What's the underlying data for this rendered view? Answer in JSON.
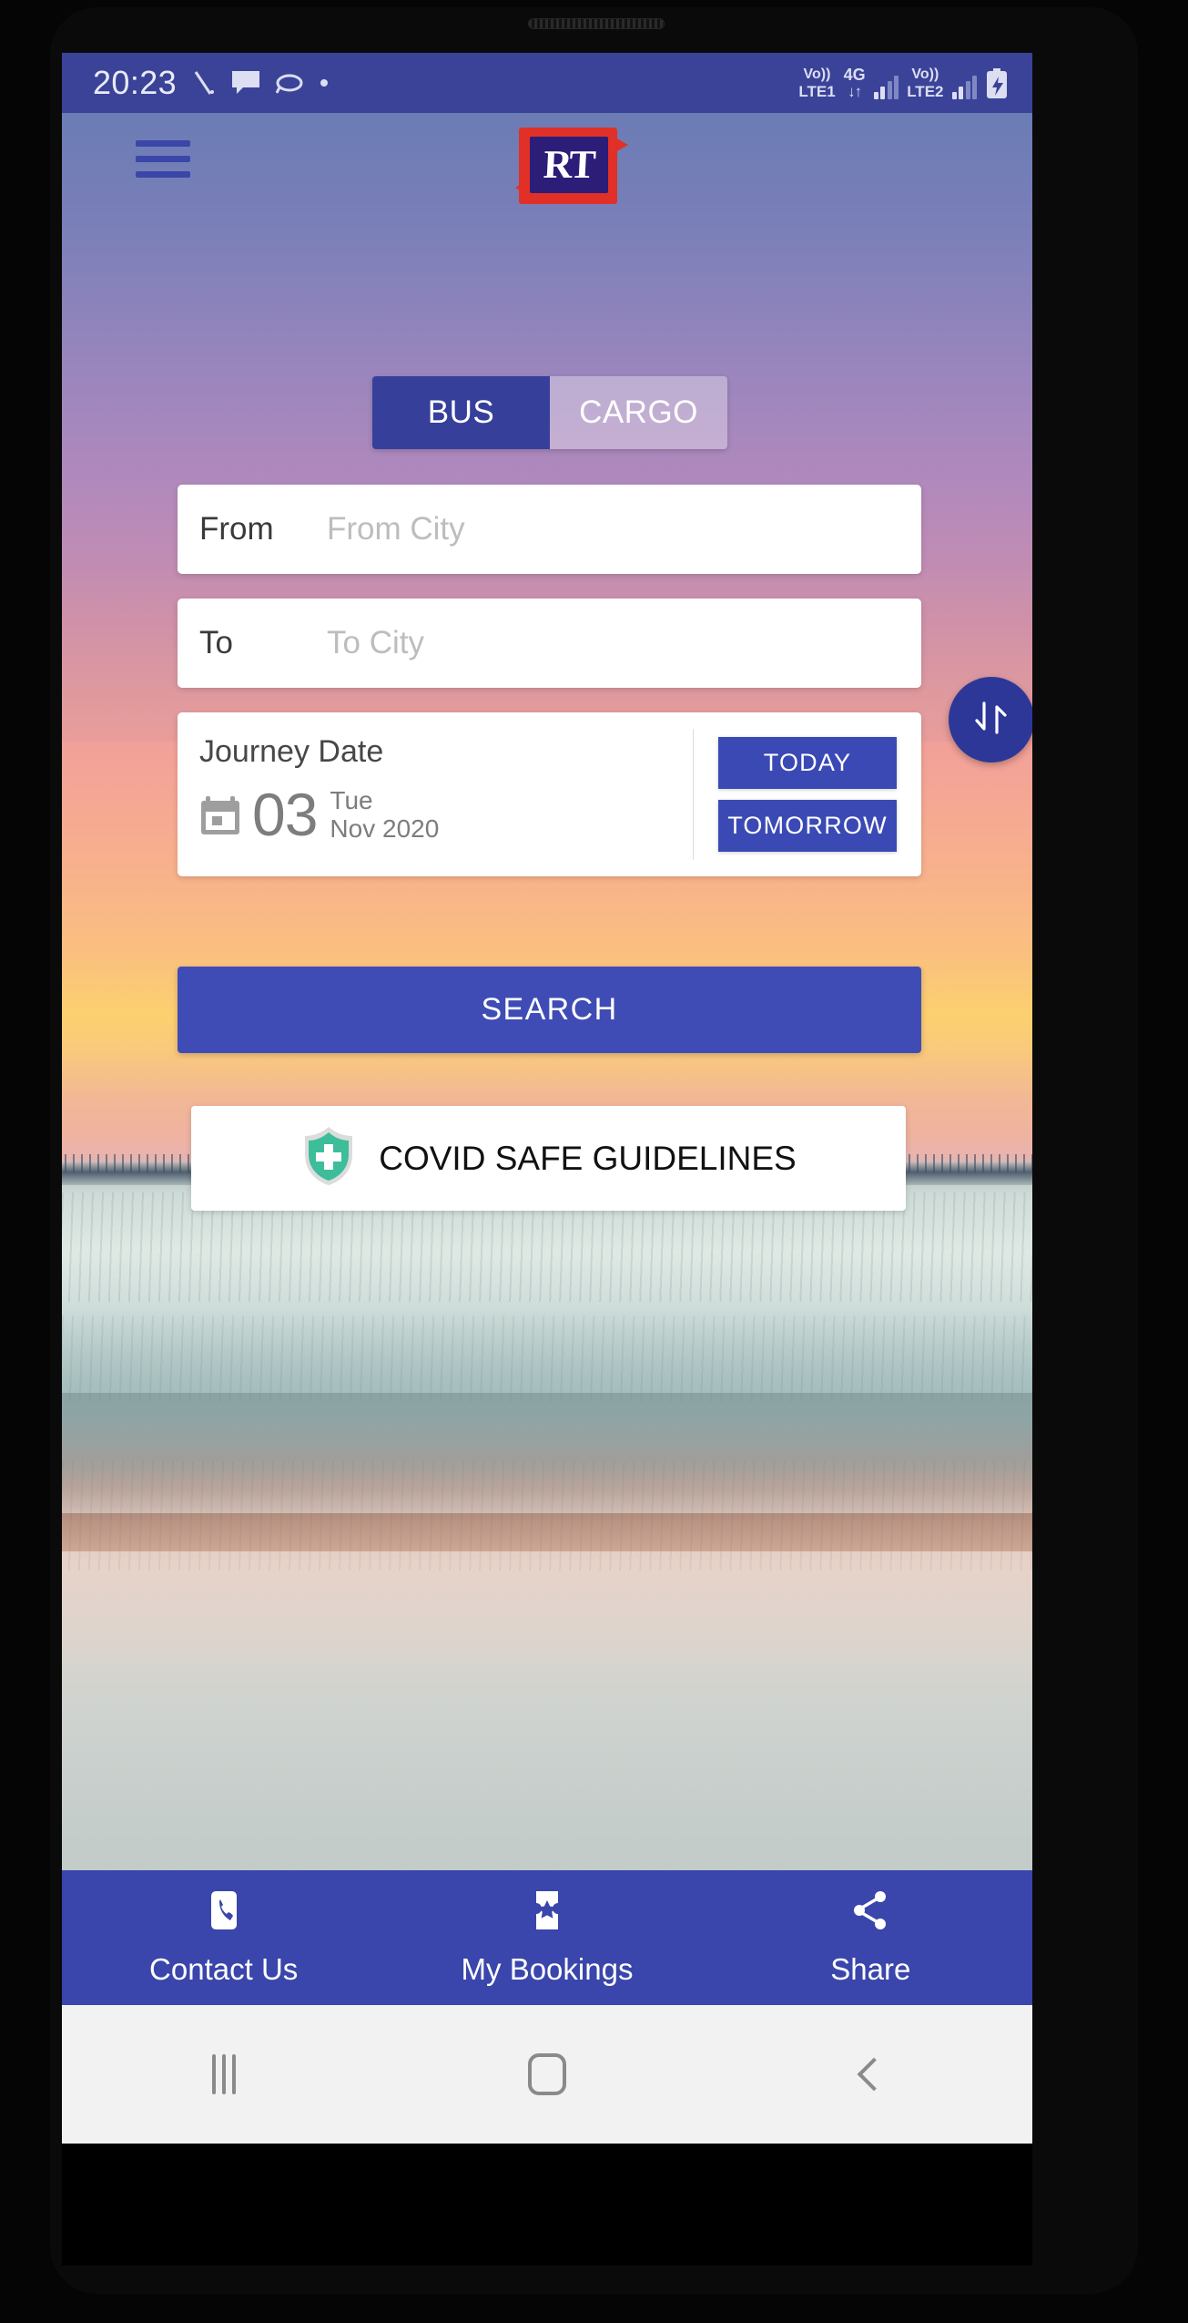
{
  "status_bar": {
    "time": "20:23",
    "left_icons": [
      "silent-mode-icon",
      "message-icon",
      "app-icon",
      "dot-icon"
    ],
    "network": {
      "sim1_volte_line1": "Vo))",
      "sim1_volte_line2": "LTE1",
      "data_type": "4G",
      "data_arrows": "↓↑",
      "sim2_volte_line1": "Vo))",
      "sim2_volte_line2": "LTE2"
    },
    "battery_icon": "battery-charging-icon",
    "background_color": "#3a4398"
  },
  "header": {
    "menu_icon": "hamburger-menu-icon",
    "logo_text": "RT",
    "logo_colors": {
      "frame": "#e03027",
      "inner": "#2b1d78",
      "text": "#ffffff"
    }
  },
  "mode_tabs": [
    {
      "label": "BUS",
      "active": true
    },
    {
      "label": "CARGO",
      "active": false
    }
  ],
  "search_form": {
    "from": {
      "label": "From",
      "value": "",
      "placeholder": "From City"
    },
    "to": {
      "label": "To",
      "value": "",
      "placeholder": "To City"
    },
    "swap_icon": "swap-vertical-icon",
    "journey": {
      "title": "Journey Date",
      "calendar_icon": "calendar-icon",
      "day": "03",
      "weekday": "Tue",
      "month_year": "Nov 2020",
      "today_label": "TODAY",
      "tomorrow_label": "TOMORROW"
    },
    "search_label": "SEARCH"
  },
  "covid_banner": {
    "icon": "shield-health-icon",
    "label": "COVID SAFE GUIDELINES",
    "shield_color": "#3dbd9a"
  },
  "bottom_nav": [
    {
      "icon": "phone-icon",
      "label": "Contact Us"
    },
    {
      "icon": "ticket-star-icon",
      "label": "My Bookings"
    },
    {
      "icon": "share-icon",
      "label": "Share"
    }
  ],
  "system_nav": [
    {
      "icon": "recents-icon"
    },
    {
      "icon": "home-icon"
    },
    {
      "icon": "back-icon"
    }
  ],
  "theme": {
    "primary_blue": "#3a46ab",
    "tab_active": "#36409b",
    "button_blue": "#3f4cb5",
    "swap_blue": "#2c3798"
  }
}
